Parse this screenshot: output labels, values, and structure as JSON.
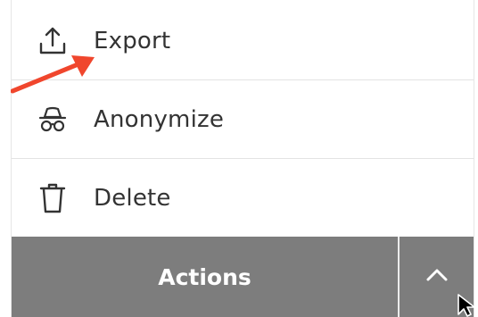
{
  "menu": {
    "items": [
      {
        "label": "Export",
        "icon": "upload-icon"
      },
      {
        "label": "Anonymize",
        "icon": "incognito-icon"
      },
      {
        "label": "Delete",
        "icon": "trash-icon"
      }
    ]
  },
  "actions": {
    "label": "Actions",
    "toggle_icon": "chevron-up-icon"
  },
  "colors": {
    "bar_background": "#7d7d7d",
    "annotation_arrow": "#f0462d",
    "text": "#333333"
  }
}
